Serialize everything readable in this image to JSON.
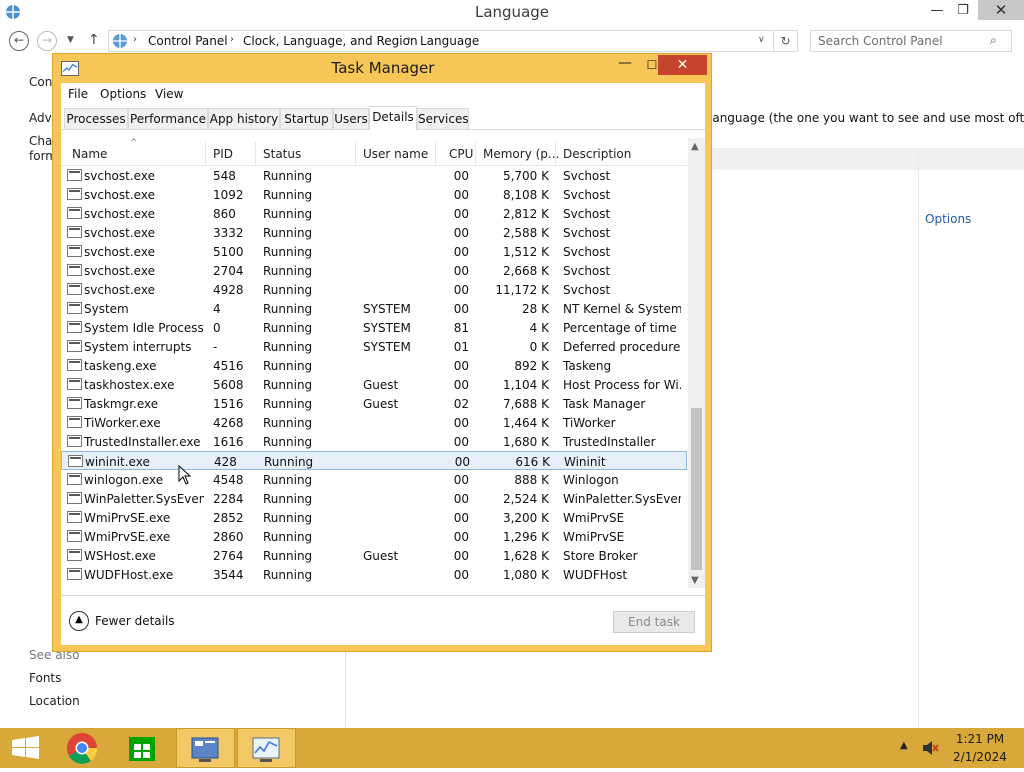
{
  "control_panel": {
    "title": "Language",
    "breadcrumb": [
      "Control Panel",
      "Clock, Language, and Region",
      "Language"
    ],
    "search_placeholder": "Search Control Panel",
    "side_labels": [
      "Cont",
      "Adva",
      "Chan",
      "form"
    ],
    "description": "language (the one you want to see and use most often).",
    "options_link": "Options",
    "see_also": "See also",
    "see_also_links": [
      "Fonts",
      "Location"
    ]
  },
  "task_manager": {
    "title": "Task Manager",
    "menu": [
      "File",
      "Options",
      "View"
    ],
    "tabs": [
      "Processes",
      "Performance",
      "App history",
      "Startup",
      "Users",
      "Details",
      "Services"
    ],
    "active_tab": "Details",
    "columns": [
      "Name",
      "PID",
      "Status",
      "User name",
      "CPU",
      "Memory (p...",
      "Description"
    ],
    "rows": [
      {
        "name": "svchost.exe",
        "pid": "548",
        "status": "Running",
        "user": "",
        "cpu": "00",
        "memory": "5,700 K",
        "desc": "Svchost"
      },
      {
        "name": "svchost.exe",
        "pid": "1092",
        "status": "Running",
        "user": "",
        "cpu": "00",
        "memory": "8,108 K",
        "desc": "Svchost"
      },
      {
        "name": "svchost.exe",
        "pid": "860",
        "status": "Running",
        "user": "",
        "cpu": "00",
        "memory": "2,812 K",
        "desc": "Svchost"
      },
      {
        "name": "svchost.exe",
        "pid": "3332",
        "status": "Running",
        "user": "",
        "cpu": "00",
        "memory": "2,588 K",
        "desc": "Svchost"
      },
      {
        "name": "svchost.exe",
        "pid": "5100",
        "status": "Running",
        "user": "",
        "cpu": "00",
        "memory": "1,512 K",
        "desc": "Svchost"
      },
      {
        "name": "svchost.exe",
        "pid": "2704",
        "status": "Running",
        "user": "",
        "cpu": "00",
        "memory": "2,668 K",
        "desc": "Svchost"
      },
      {
        "name": "svchost.exe",
        "pid": "4928",
        "status": "Running",
        "user": "",
        "cpu": "00",
        "memory": "11,172 K",
        "desc": "Svchost"
      },
      {
        "name": "System",
        "pid": "4",
        "status": "Running",
        "user": "SYSTEM",
        "cpu": "00",
        "memory": "28 K",
        "desc": "NT Kernel & System"
      },
      {
        "name": "System Idle Process",
        "pid": "0",
        "status": "Running",
        "user": "SYSTEM",
        "cpu": "81",
        "memory": "4 K",
        "desc": "Percentage of time t..."
      },
      {
        "name": "System interrupts",
        "pid": "-",
        "status": "Running",
        "user": "SYSTEM",
        "cpu": "01",
        "memory": "0 K",
        "desc": "Deferred procedure ..."
      },
      {
        "name": "taskeng.exe",
        "pid": "4516",
        "status": "Running",
        "user": "",
        "cpu": "00",
        "memory": "892 K",
        "desc": "Taskeng"
      },
      {
        "name": "taskhostex.exe",
        "pid": "5608",
        "status": "Running",
        "user": "Guest",
        "cpu": "00",
        "memory": "1,104 K",
        "desc": "Host Process for Wi..."
      },
      {
        "name": "Taskmgr.exe",
        "pid": "1516",
        "status": "Running",
        "user": "Guest",
        "cpu": "02",
        "memory": "7,688 K",
        "desc": "Task Manager"
      },
      {
        "name": "TiWorker.exe",
        "pid": "4268",
        "status": "Running",
        "user": "",
        "cpu": "00",
        "memory": "1,464 K",
        "desc": "TiWorker"
      },
      {
        "name": "TrustedInstaller.exe",
        "pid": "1616",
        "status": "Running",
        "user": "",
        "cpu": "00",
        "memory": "1,680 K",
        "desc": "TrustedInstaller"
      },
      {
        "name": "wininit.exe",
        "pid": "428",
        "status": "Running",
        "user": "",
        "cpu": "00",
        "memory": "616 K",
        "desc": "Wininit",
        "selected": true
      },
      {
        "name": "winlogon.exe",
        "pid": "4548",
        "status": "Running",
        "user": "",
        "cpu": "00",
        "memory": "888 K",
        "desc": "Winlogon"
      },
      {
        "name": "WinPaletter.SysEvent...",
        "pid": "2284",
        "status": "Running",
        "user": "",
        "cpu": "00",
        "memory": "2,524 K",
        "desc": "WinPaletter.SysEven..."
      },
      {
        "name": "WmiPrvSE.exe",
        "pid": "2852",
        "status": "Running",
        "user": "",
        "cpu": "00",
        "memory": "3,200 K",
        "desc": "WmiPrvSE"
      },
      {
        "name": "WmiPrvSE.exe",
        "pid": "2860",
        "status": "Running",
        "user": "",
        "cpu": "00",
        "memory": "1,296 K",
        "desc": "WmiPrvSE"
      },
      {
        "name": "WSHost.exe",
        "pid": "2764",
        "status": "Running",
        "user": "Guest",
        "cpu": "00",
        "memory": "1,628 K",
        "desc": "Store Broker"
      },
      {
        "name": "WUDFHost.exe",
        "pid": "3544",
        "status": "Running",
        "user": "",
        "cpu": "00",
        "memory": "1,080 K",
        "desc": "WUDFHost"
      }
    ],
    "fewer_details": "Fewer details",
    "end_task": "End task"
  },
  "taskbar": {
    "time": "1:21 PM",
    "date": "2/1/2024",
    "icons": [
      "start-icon",
      "chrome-icon",
      "store-icon",
      "control-panel-icon",
      "task-manager-icon"
    ]
  },
  "colors": {
    "accent": "#f6c758",
    "taskbar": "#d8a83a",
    "close_red": "#c7442c",
    "selection": "#e6f0fa"
  }
}
